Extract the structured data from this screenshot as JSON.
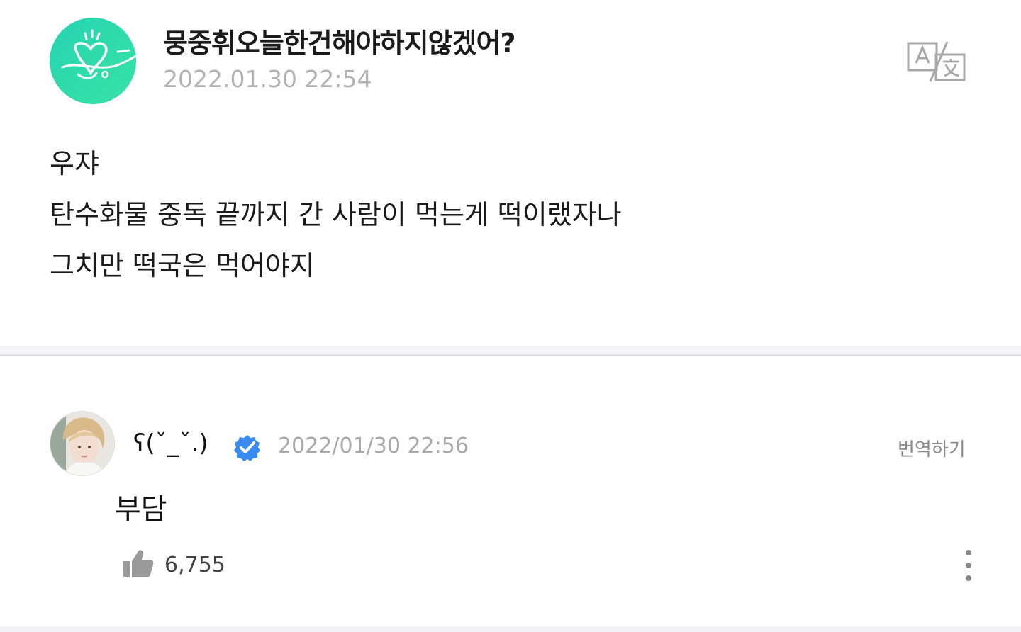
{
  "post": {
    "title": "뭉중휘오늘한건해야하지않겠어?",
    "timestamp": "2022.01.30 22:54",
    "avatar_icon": "heart-doodle-logo",
    "translate_icon": "translate-icon",
    "body_lines": [
      "우쟈",
      "탄수화물 중독 끝까지 간 사람이 먹는게 떡이랬자나",
      "그치만 떡국은 먹어야지"
    ]
  },
  "comment": {
    "author": "ʕ(ˇ_ˇ.)",
    "verified_icon": "verified-badge-icon",
    "timestamp": "2022/01/30 22:56",
    "translate_label": "번역하기",
    "text": "부담",
    "like_count": "6,755",
    "more_icon": "more-vertical-icon"
  },
  "colors": {
    "avatar_gradient": "#27d3b2",
    "verified_blue": "#3b8cf0",
    "timestamp_gray": "#b2b2b2",
    "divider": "#f4f4f8"
  }
}
